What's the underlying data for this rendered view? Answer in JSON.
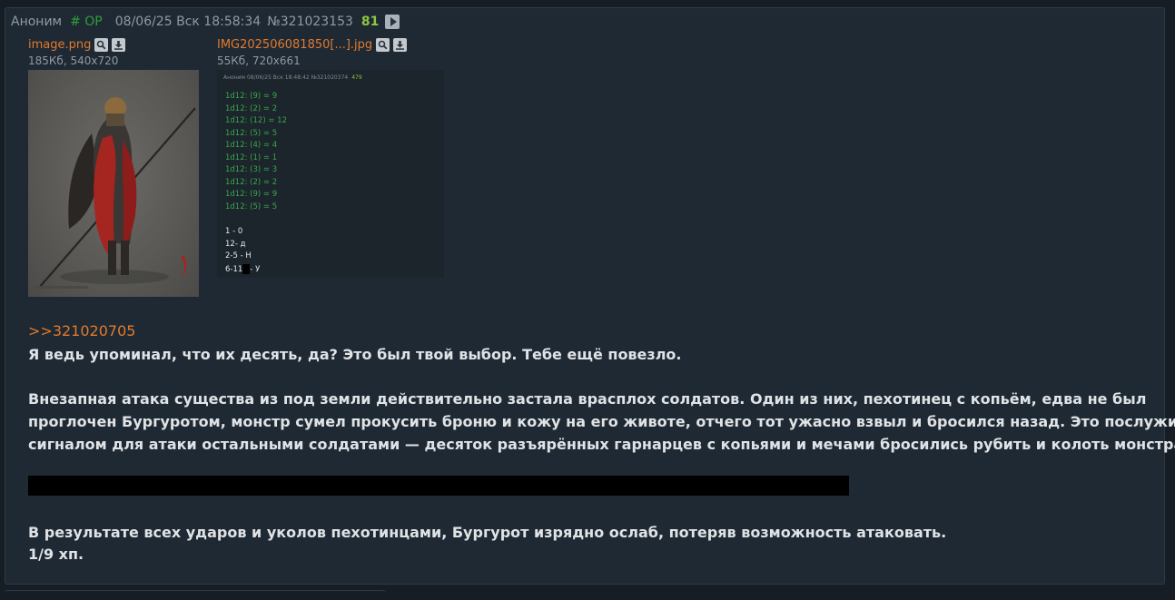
{
  "post": {
    "author": "Аноним",
    "op_tag": "# OP",
    "date": "08/06/25 Вск 18:58:34",
    "number": "№321023153",
    "count": "81"
  },
  "files": [
    {
      "name": "image.png",
      "meta": "185Кб, 540x720"
    },
    {
      "name": "IMG202506081850[...].jpg",
      "meta": "55Кб, 720x661"
    }
  ],
  "thumb2": {
    "header": "Аноним 08/06/25 Вск 18:48:42 №321020374",
    "header_count": "479",
    "rolls": [
      "1d12: (9) = 9",
      "1d12: (2) = 2",
      "1d12: (12) = 12",
      "1d12: (5) = 5",
      "1d12: (4) = 4",
      "1d12: (1) = 1",
      "1d12: (3) = 3",
      "1d12: (2) = 2",
      "1d12: (9) = 9",
      "1d12: (5) = 5"
    ],
    "results": [
      "1 - 0",
      "12- д",
      "2-5 - Н",
      "6-11",
      "- У"
    ]
  },
  "reply_link": ">>321020705",
  "body": {
    "line1": "Я ведь упоминал, что их десять, да? Это был твой выбор. Тебе ещё повезло.",
    "para2_l1": "Внезапная атака существа из под земли действительно застала врасплох солдатов. Один из них, пехотинец с копьём, едва не был",
    "para2_l2": "проглочен Бургуротом, монстр сумел прокусить броню и кожу на его животе, отчего тот ужасно взвыл и бросился назад. Это послужило",
    "para2_l3": "сигналом для атаки остальными солдатами — десяток разъярённых гарнарцев с копьями и мечами бросились рубить и колоть монстра.",
    "para3_l1": "В результате всех ударов и уколов пехотинцами, Бургурот изрядно ослаб, потеряв возможность атаковать.",
    "para3_l2": "1/9 хп."
  },
  "colors": {
    "background": "#171d24",
    "post_bg": "#1f2933",
    "link": "#e07a2e",
    "op": "#2f9e3a",
    "count": "#8ec63f"
  },
  "icons": [
    "play-icon",
    "search-icon",
    "download-icon"
  ]
}
